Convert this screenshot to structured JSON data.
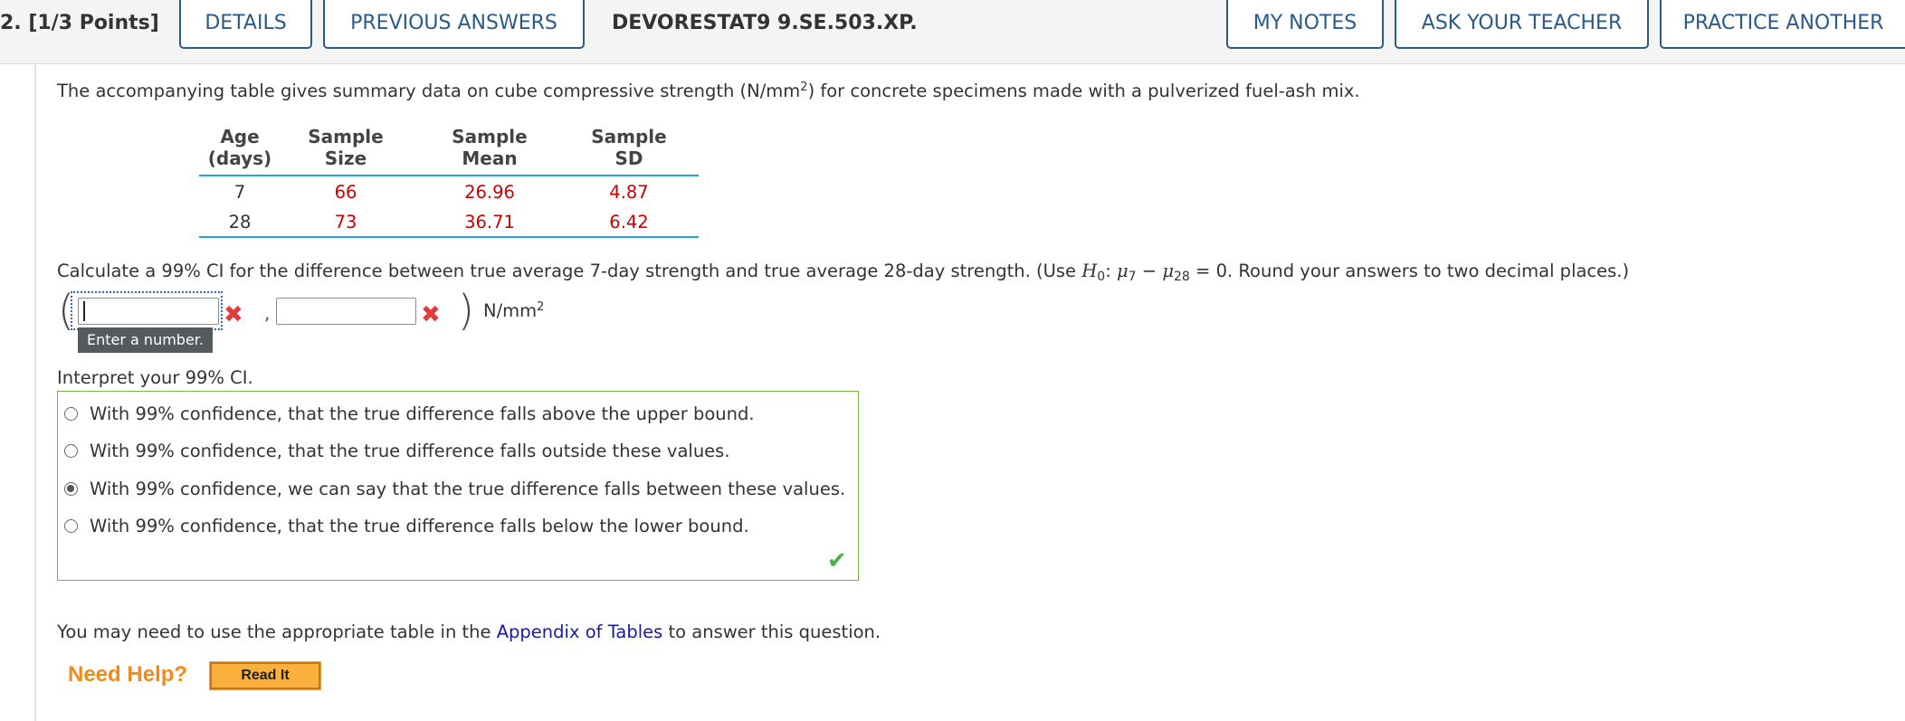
{
  "header": {
    "question_number": "2. [1/3 Points]",
    "details": "DETAILS",
    "previous_answers": "PREVIOUS ANSWERS",
    "question_code": "DEVORESTAT9 9.SE.503.XP.",
    "my_notes": "MY NOTES",
    "ask_teacher": "ASK YOUR TEACHER",
    "practice_another": "PRACTICE ANOTHER"
  },
  "intro": {
    "before_sup": "The accompanying table gives summary data on cube compressive strength (N/mm",
    "sup": "2",
    "after_sup": ") for concrete specimens made with a pulverized fuel-ash mix."
  },
  "table": {
    "headers": [
      [
        "Age",
        "(days)"
      ],
      [
        "Sample",
        "Size"
      ],
      [
        "Sample",
        "Mean"
      ],
      [
        "Sample",
        "SD"
      ]
    ],
    "rows": [
      [
        "7",
        "66",
        "26.96",
        "4.87"
      ],
      [
        "28",
        "73",
        "36.71",
        "6.42"
      ]
    ]
  },
  "question": {
    "text1": "Calculate a 99% CI for the difference between true average 7-day strength and true average 28-day strength. (Use ",
    "h": "H",
    "h_sub": "0",
    "colon": ": ",
    "mu1": "μ",
    "mu1_sub": "7",
    "minus": " − ",
    "mu2": "μ",
    "mu2_sub": "28",
    "text2": " = 0. Round your answers to two decimal places.)"
  },
  "answer": {
    "lower_value": "",
    "upper_value": "",
    "open_paren": "(",
    "close_paren": ")",
    "comma": ",",
    "unit_base": "N/mm",
    "unit_sup": "2",
    "tooltip": "Enter a number.",
    "wrong_mark": "✖"
  },
  "interpret": {
    "label": "Interpret your 99% CI.",
    "options": [
      "With 99% confidence, that the true difference falls above the upper bound.",
      "With 99% confidence, that the true difference falls outside these values.",
      "With 99% confidence, we can say that the true difference falls between these values.",
      "With 99% confidence, that the true difference falls below the lower bound."
    ],
    "selected_index": 2,
    "correct_mark": "✔"
  },
  "help": {
    "text_before": "You may need to use the appropriate table in the ",
    "link": "Appendix of Tables",
    "text_after": " to answer this question.",
    "need_help": "Need Help?",
    "read_it": "Read It"
  },
  "colors": {
    "tab_border": "#2b5a8a",
    "value_red": "#cc0000",
    "table_rule": "#2aa0d8",
    "correct_green": "#7cb342",
    "need_help_orange": "#f08a1a",
    "link_blue": "#1a1aa6"
  }
}
